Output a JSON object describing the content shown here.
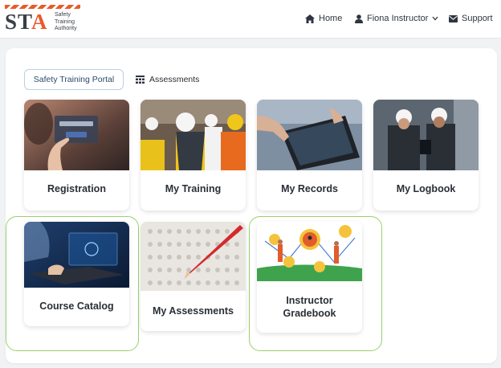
{
  "header": {
    "logo": {
      "letters": [
        "S",
        "T",
        "A"
      ],
      "tagline_lines": [
        "Safety",
        "Training",
        "Authority"
      ]
    },
    "nav": {
      "home": {
        "label": "Home",
        "icon": "home-icon"
      },
      "user": {
        "label": "Fiona Instructor",
        "icon": "user-icon",
        "dropdown_icon": "chevron-down-icon"
      },
      "support": {
        "label": "Support",
        "icon": "envelope-icon"
      }
    }
  },
  "tabs": {
    "portal": {
      "label": "Safety Training Portal"
    },
    "assessments": {
      "label": "Assessments",
      "icon": "assessments-grid-icon"
    }
  },
  "tiles": [
    {
      "label": "Registration",
      "image": "tablet-login-screen"
    },
    {
      "label": "My Training",
      "image": "workers-in-hardhats"
    },
    {
      "label": "My Records",
      "image": "tablet-in-hand"
    },
    {
      "label": "My Logbook",
      "image": "engineers-with-tablet"
    },
    {
      "label": "Course Catalog",
      "image": "laptop-online-learning",
      "highlighted": true
    },
    {
      "label": "My Assessments",
      "image": "answer-sheet-with-pencil"
    },
    {
      "label_lines": [
        "Instructor",
        "Gradebook"
      ],
      "image": "security-illustration",
      "highlighted": true
    }
  ],
  "colors": {
    "brand_orange": "#e95a2b",
    "highlight_green": "#9ad06e",
    "tab_border": "#b9cfe6"
  }
}
